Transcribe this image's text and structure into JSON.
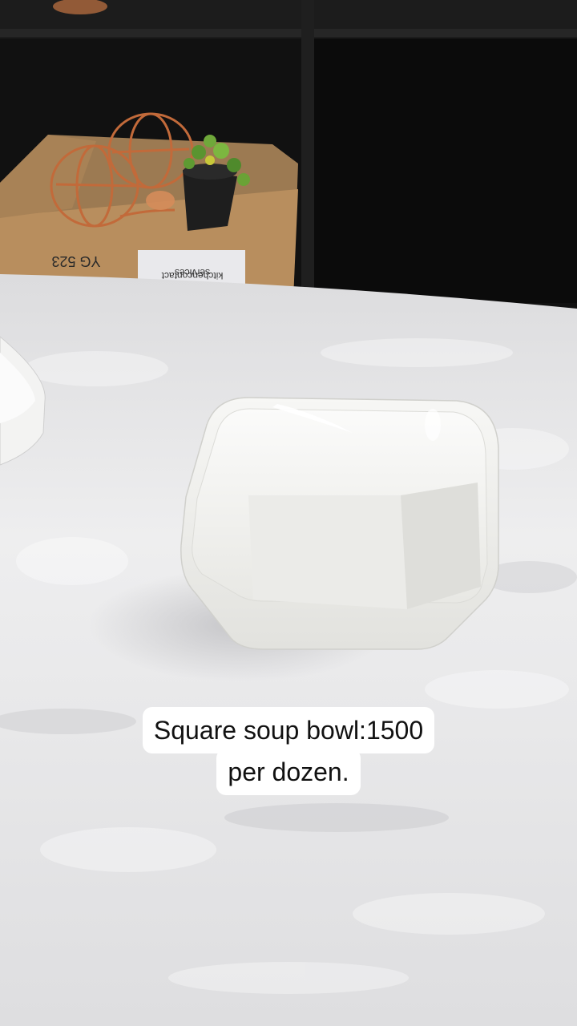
{
  "caption": {
    "line1": "Square soup bowl:1500",
    "line2": "per dozen."
  },
  "box_label": {
    "code": "YG 523",
    "sticker_line1": "kitchencontact",
    "sticker_line2": "services"
  },
  "colors": {
    "shelf": "#141414",
    "tablecloth": "#e6e6e8",
    "bowl": "#f4f4f3",
    "box": "#b88e5e",
    "copper": "#c26a3a"
  }
}
